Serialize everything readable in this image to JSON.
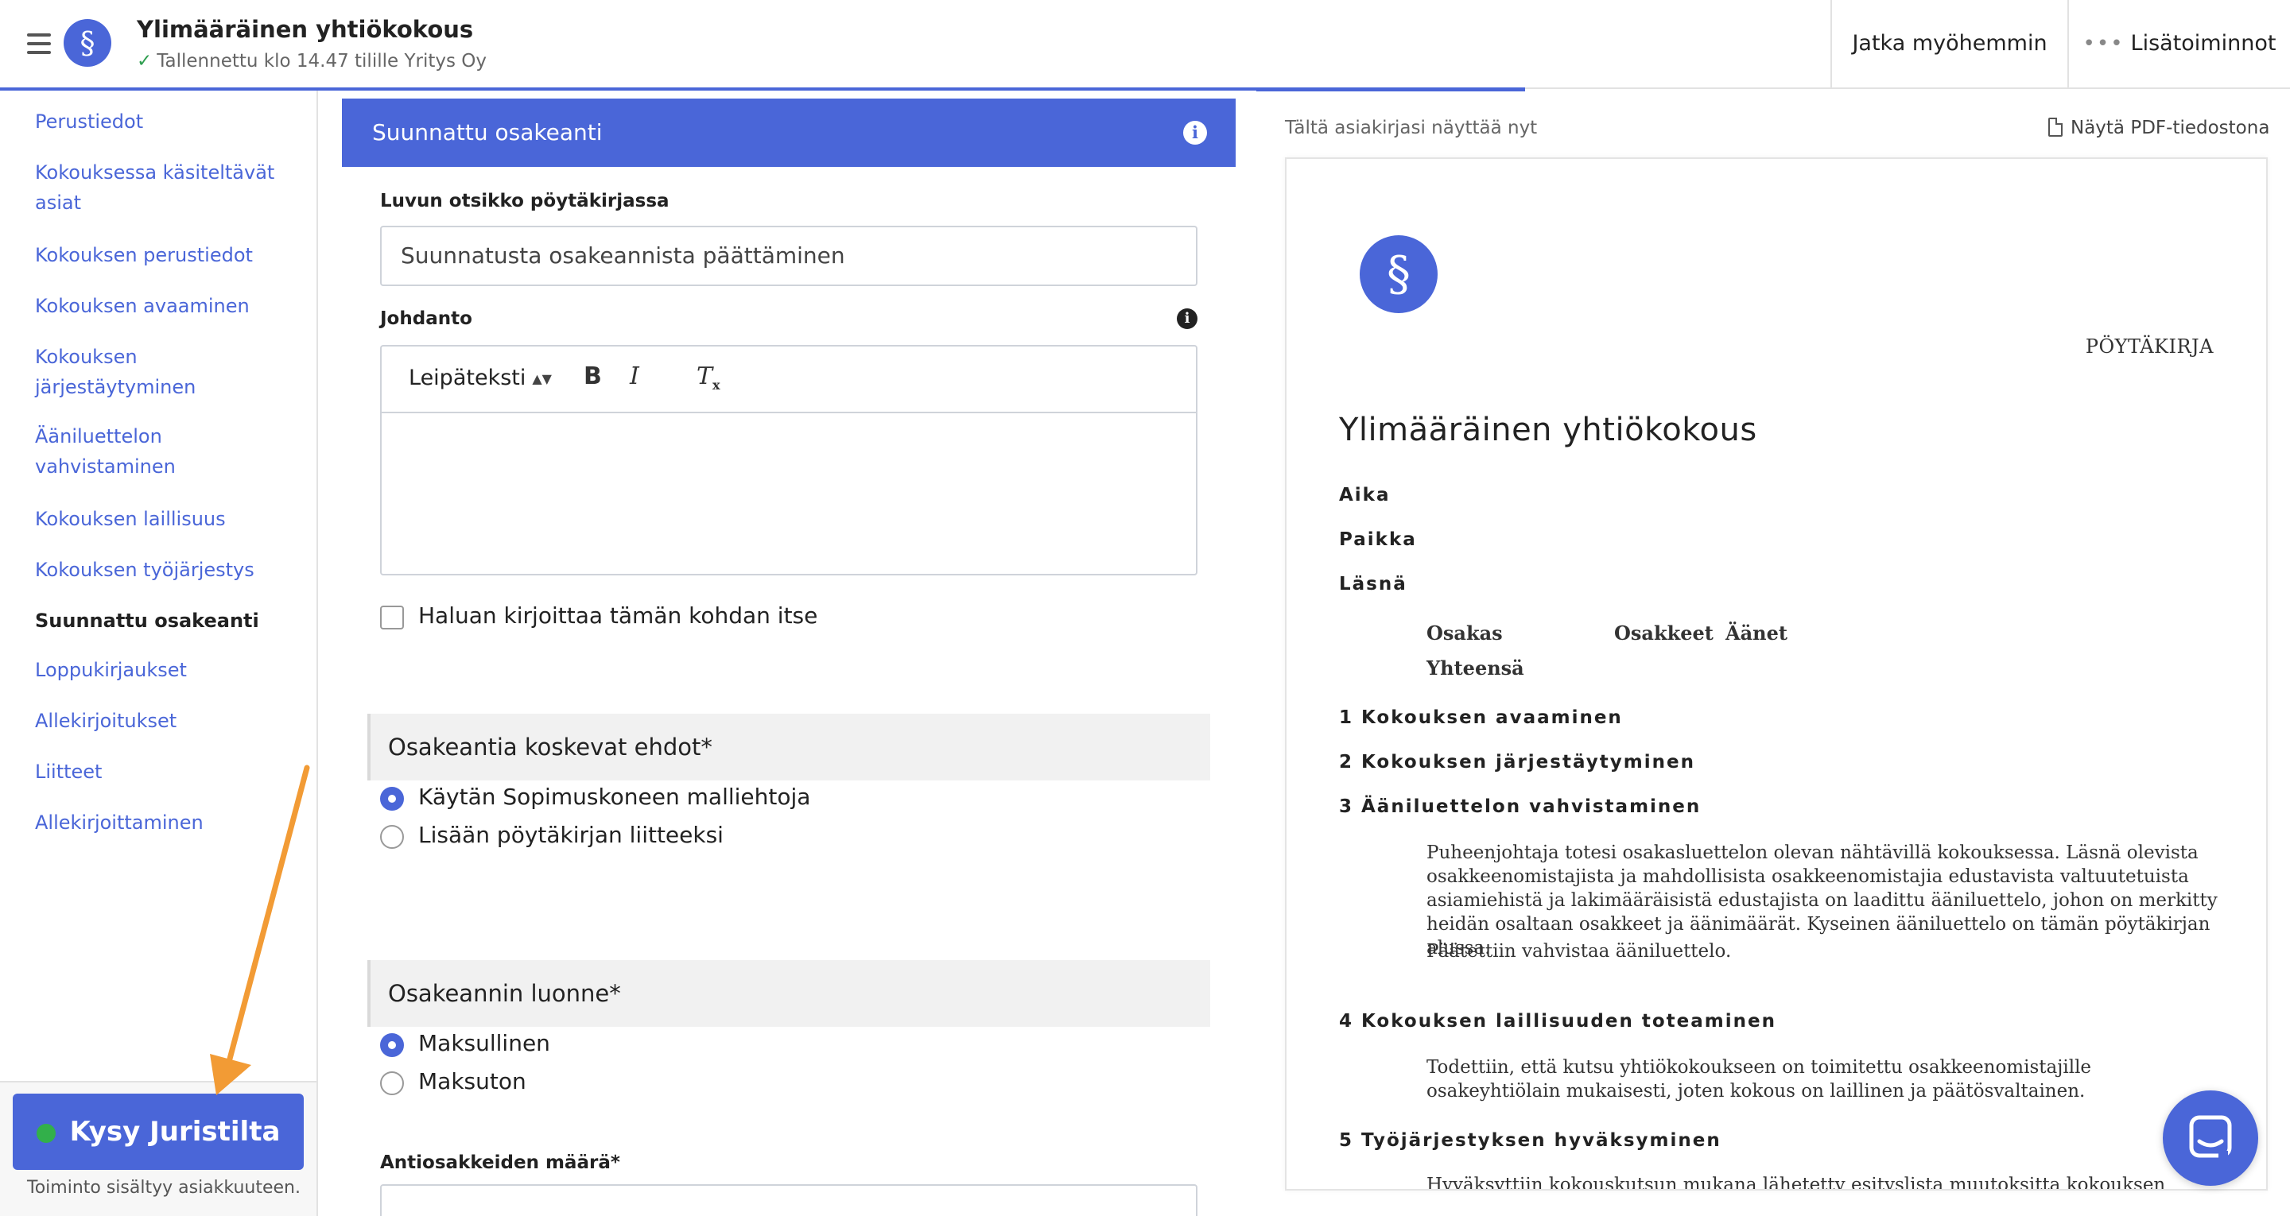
{
  "header": {
    "title": "Ylimääräinen yhtiökokous",
    "saved_status": "Tallennettu klo 14.47 tilille Yritys Oy",
    "continue_later": "Jatka myöhemmin",
    "more_actions": "Lisätoiminnot",
    "progress": 0.666
  },
  "sidebar": {
    "items": [
      {
        "label": "Perustiedot"
      },
      {
        "label": "Kokouksessa käsiteltävät asiat"
      },
      {
        "label": "Kokouksen perustiedot"
      },
      {
        "label": "Kokouksen avaaminen"
      },
      {
        "label": "Kokouksen järjestäytyminen"
      },
      {
        "label": "Ääniluettelon vahvistaminen"
      },
      {
        "label": "Kokouksen laillisuus"
      },
      {
        "label": "Kokouksen työjärjestys"
      },
      {
        "label": "Suunnattu osakeanti"
      },
      {
        "label": "Loppukirjaukset"
      },
      {
        "label": "Allekirjoitukset"
      },
      {
        "label": "Liitteet"
      },
      {
        "label": "Allekirjoittaminen"
      }
    ],
    "active_index": 8,
    "ask_button": "Kysy Juristilta",
    "ask_note": "Toiminto sisältyy asiakkuuteen."
  },
  "form": {
    "section_title": "Suunnattu osakeanti",
    "heading_label": "Luvun otsikko pöytäkirjassa",
    "heading_value": "Suunnatusta osakeannista päättäminen",
    "intro_label": "Johdanto",
    "style_select": "Leipäteksti",
    "bold": "B",
    "italic": "I",
    "clear_format": "T",
    "clear_format_sub": "x",
    "write_myself": "Haluan kirjoittaa tämän kohdan itse",
    "terms_group": "Osakeantia koskevat ehdot*",
    "terms_options": [
      "Käytän Sopimuskoneen malliehtoja",
      "Lisään pöytäkirjan liitteeksi"
    ],
    "nature_group": "Osakeannin luonne*",
    "nature_options": [
      "Maksullinen",
      "Maksuton"
    ],
    "shares_label": "Antiosakkeiden määrä*"
  },
  "preview": {
    "heading": "Tältä asiakirjasi näyttää nyt",
    "pdf_link": "Näytä PDF-tiedostona",
    "doc_type": "PÖYTÄKIRJA",
    "doc_title": "Ylimääräinen yhtiökokous",
    "meta": [
      "Aika",
      "Paikka",
      "Läsnä"
    ],
    "table_headers": [
      "Osakas",
      "Osakkeet",
      "Äänet"
    ],
    "table_total": "Yhteensä",
    "sections": [
      {
        "title": "1 Kokouksen avaaminen"
      },
      {
        "title": "2 Kokouksen järjestäytyminen"
      },
      {
        "title": "3 Ääniluettelon vahvistaminen",
        "paragraphs": [
          "Puheenjohtaja totesi osakasluettelon olevan nähtävillä kokouksessa. Läsnä olevista osakkeenomistajista ja mahdollisista osakkeenomistajia edustavista valtuutetuista asiamiehistä ja lakimääräisistä edustajista on laadittu ääniluettelo, johon on merkitty heidän osaltaan osakkeet ja äänimäärät. Kyseinen ääniluettelo on tämän pöytäkirjan alussa.",
          "Päätettiin vahvistaa ääniluettelo."
        ]
      },
      {
        "title": "4 Kokouksen laillisuuden toteaminen",
        "paragraphs": [
          "Todettiin, että kutsu yhtiökokoukseen on toimitettu osakkeenomistajille osakeyhtiölain mukaisesti, joten kokous on laillinen ja päätösvaltainen."
        ]
      },
      {
        "title": "5 Työjärjestyksen hyväksyminen",
        "paragraphs": [
          "Hyväksyttiin kokouskutsun mukana lähetetty esityslista muutoksitta kokouksen"
        ]
      }
    ]
  }
}
